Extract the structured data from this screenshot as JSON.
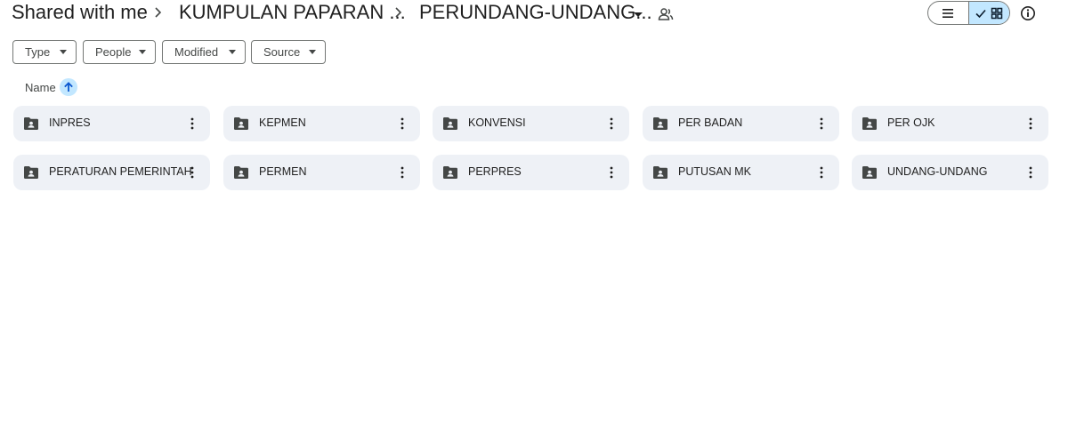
{
  "breadcrumb": {
    "items": [
      "Shared with me",
      "KUMPULAN PAPARAN ...",
      "PERUNDANG-UNDANG..."
    ]
  },
  "icons": {
    "separator": "chevron-right-icon",
    "dropdown": "caret-down-icon",
    "shared": "shared-folder-people-icon",
    "list_view": "list-view-icon",
    "grid_view": "grid-view-icon",
    "info": "info-icon",
    "folder": "shared-folder-icon",
    "more": "more-vert-icon",
    "sort": "arrow-up-icon"
  },
  "view": {
    "selected": "grid"
  },
  "filters": [
    "Type",
    "People",
    "Modified",
    "Source"
  ],
  "sort": {
    "label": "Name",
    "direction": "ascending"
  },
  "folders": [
    "INPRES",
    "KEPMEN",
    "KONVENSI",
    "PER BADAN",
    "PER OJK",
    "PERATURAN PEMERINTAH",
    "PERMEN",
    "PERPRES",
    "PUTUSAN MK",
    "UNDANG-UNDANG"
  ],
  "colors": {
    "chip_border": "#747775",
    "selected_bg": "#c2e7ff",
    "folder_card_bg": "#eef1f6",
    "text": "#1f1f1f"
  }
}
